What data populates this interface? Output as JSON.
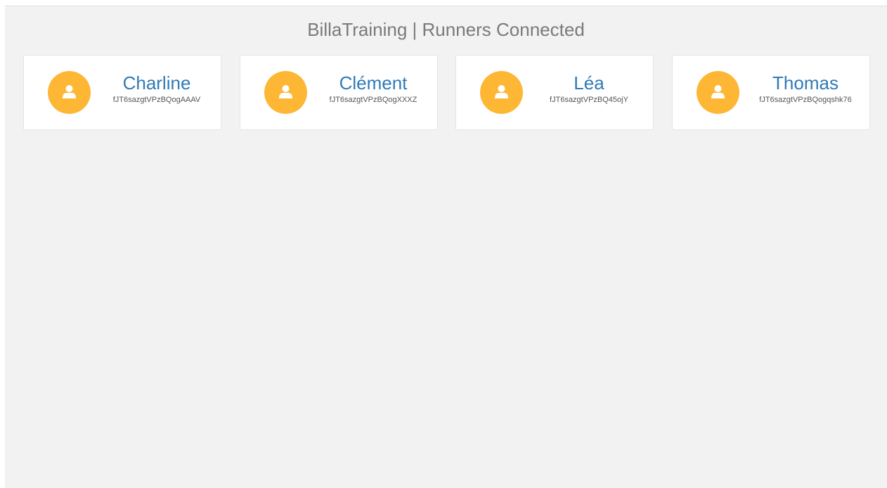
{
  "header": {
    "title": "BillaTraining | Runners Connected"
  },
  "runners": [
    {
      "name": "Charline",
      "id": "fJT6sazgtVPzBQogAAAV"
    },
    {
      "name": "Clément",
      "id": "fJT6sazgtVPzBQogXXXZ"
    },
    {
      "name": "Léa",
      "id": "fJT6sazgtVPzBQ45ojY"
    },
    {
      "name": "Thomas",
      "id": "fJT6sazgtVPzBQogqshk76"
    }
  ],
  "colors": {
    "avatar_bg": "#fdb734",
    "name_text": "#2f7ab7",
    "background": "#f2f2f2"
  },
  "icons": {
    "avatar": "user-icon"
  }
}
